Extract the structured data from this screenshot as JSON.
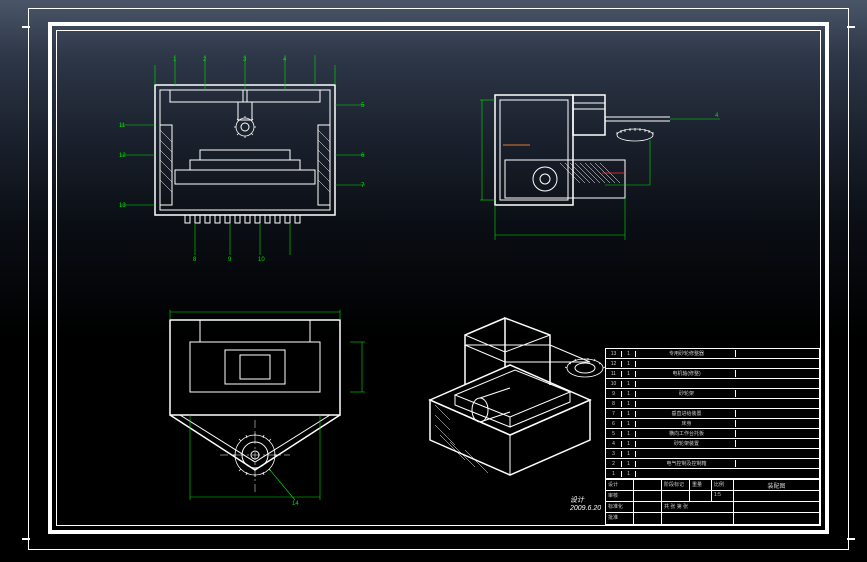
{
  "drawing": {
    "sheet_size": "A3",
    "frame_style": "double-border"
  },
  "callouts": {
    "view1": [
      "1",
      "2",
      "3",
      "4",
      "5",
      "6",
      "7",
      "8",
      "9",
      "10",
      "11",
      "12",
      "13"
    ],
    "view2": [
      "4"
    ],
    "view4": [
      "14"
    ]
  },
  "signature": {
    "line1": "设计",
    "line2": "2009.6.20"
  },
  "bom": [
    {
      "num": "13",
      "qty": "1",
      "name": "专用砂轮修整器",
      "material": "",
      "note": ""
    },
    {
      "num": "12",
      "qty": "1",
      "name": "",
      "material": "",
      "note": ""
    },
    {
      "num": "11",
      "qty": "1",
      "name": "电机轴(修整)",
      "material": "",
      "note": ""
    },
    {
      "num": "10",
      "qty": "1",
      "name": "",
      "material": "",
      "note": ""
    },
    {
      "num": "9",
      "qty": "1",
      "name": "砂轮架",
      "material": "",
      "note": ""
    },
    {
      "num": "8",
      "qty": "1",
      "name": "",
      "material": "",
      "note": ""
    },
    {
      "num": "7",
      "qty": "1",
      "name": "垂直进给装置",
      "material": "",
      "note": ""
    },
    {
      "num": "6",
      "qty": "1",
      "name": "床身",
      "material": "",
      "note": ""
    },
    {
      "num": "5",
      "qty": "1",
      "name": "横向工作台托板",
      "material": "",
      "note": ""
    },
    {
      "num": "4",
      "qty": "1",
      "name": "砂轮架装置",
      "material": "",
      "note": ""
    },
    {
      "num": "3",
      "qty": "1",
      "name": "",
      "material": "",
      "note": ""
    },
    {
      "num": "2",
      "qty": "1",
      "name": "电气控制及控制箱",
      "material": "",
      "note": ""
    },
    {
      "num": "1",
      "qty": "1",
      "name": "",
      "material": "",
      "note": ""
    }
  ],
  "title_block": {
    "drawing_name": "装配图",
    "drawing_number": "",
    "scale_label": "比例",
    "scale": "1:5",
    "sheet_label": "共 张 第 张",
    "designed_label": "设计",
    "check_label": "审核",
    "std_label": "标准化",
    "approve_label": "批准",
    "stage": "阶段标记",
    "weight_label": "重量",
    "material": "",
    "date": ""
  },
  "colors": {
    "bg": "#000000",
    "line": "#ffffff",
    "dim": "#00e000",
    "accent": "#d97b31"
  }
}
